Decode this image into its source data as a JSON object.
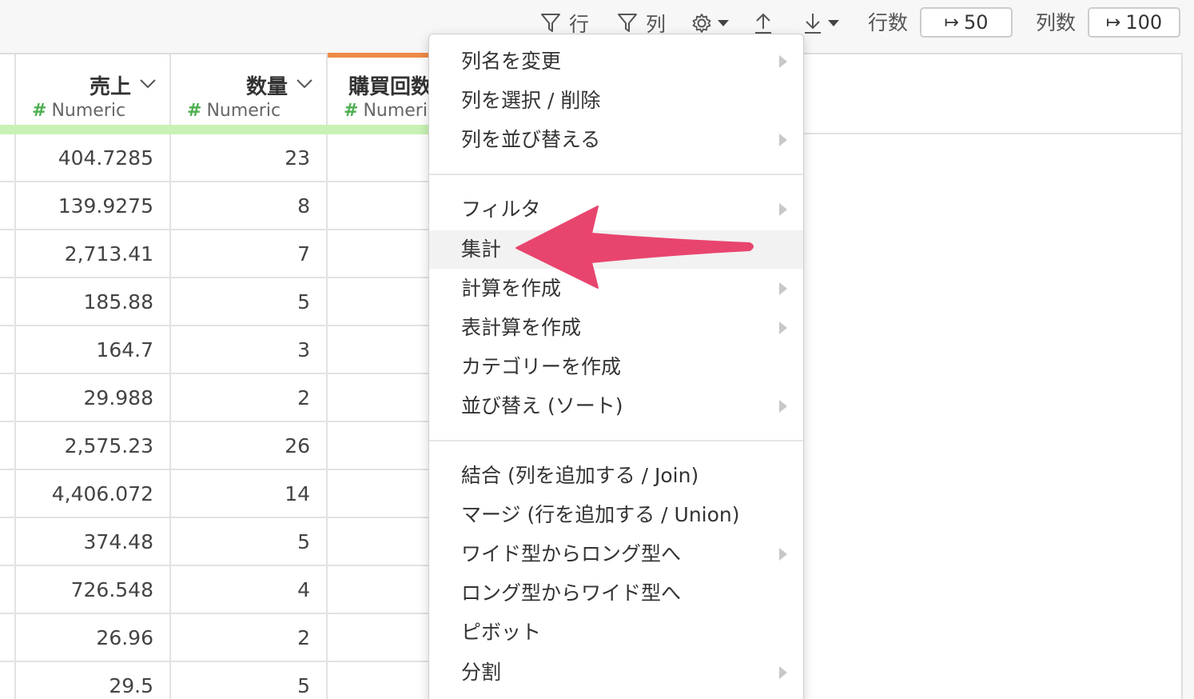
{
  "toolbar": {
    "row_filter_label": "行",
    "col_filter_label": "列",
    "rows_label": "行数",
    "rows_value": "50",
    "cols_label": "列数",
    "cols_value": "100",
    "limit_arrow": "↦"
  },
  "columns": [
    {
      "title": "売上",
      "type_icon": "#",
      "type": "Numeric"
    },
    {
      "title": "数量",
      "type_icon": "#",
      "type": "Numeric"
    },
    {
      "title": "購買回数",
      "type_icon": "#",
      "type": "Numeric"
    }
  ],
  "rows": [
    [
      "404.7285",
      "23"
    ],
    [
      "139.9275",
      "8"
    ],
    [
      "2,713.41",
      "7"
    ],
    [
      "185.88",
      "5"
    ],
    [
      "164.7",
      "3"
    ],
    [
      "29.988",
      "2"
    ],
    [
      "2,575.23",
      "26"
    ],
    [
      "4,406.072",
      "14"
    ],
    [
      "374.48",
      "5"
    ],
    [
      "726.548",
      "4"
    ],
    [
      "26.96",
      "2"
    ],
    [
      "29.5",
      "5"
    ]
  ],
  "menu": {
    "group1": [
      {
        "label": "列名を変更",
        "submenu": true
      },
      {
        "label": "列を選択 / 削除",
        "submenu": false
      },
      {
        "label": "列を並び替える",
        "submenu": true
      }
    ],
    "group2": [
      {
        "label": "フィルタ",
        "submenu": true
      },
      {
        "label": "集計",
        "submenu": false,
        "highlighted": true
      },
      {
        "label": "計算を作成",
        "submenu": true
      },
      {
        "label": "表計算を作成",
        "submenu": true
      },
      {
        "label": "カテゴリーを作成",
        "submenu": false
      },
      {
        "label": "並び替え (ソート)",
        "submenu": true
      }
    ],
    "group3": [
      {
        "label": "結合 (列を追加する / Join)",
        "submenu": false
      },
      {
        "label": "マージ (行を追加する / Union)",
        "submenu": false
      },
      {
        "label": "ワイド型からロング型へ",
        "submenu": true
      },
      {
        "label": "ロング型からワイド型へ",
        "submenu": false
      },
      {
        "label": "ピボット",
        "submenu": false
      },
      {
        "label": "分割",
        "submenu": true
      }
    ]
  },
  "annotation": {
    "arrow_color": "#e8456e"
  },
  "colors": {
    "numeric_hash": "#4caf50",
    "header_bar": "#c8f2b5",
    "active_column_bar": "#ee8a46",
    "menu_highlight": "#f2f2f2"
  }
}
